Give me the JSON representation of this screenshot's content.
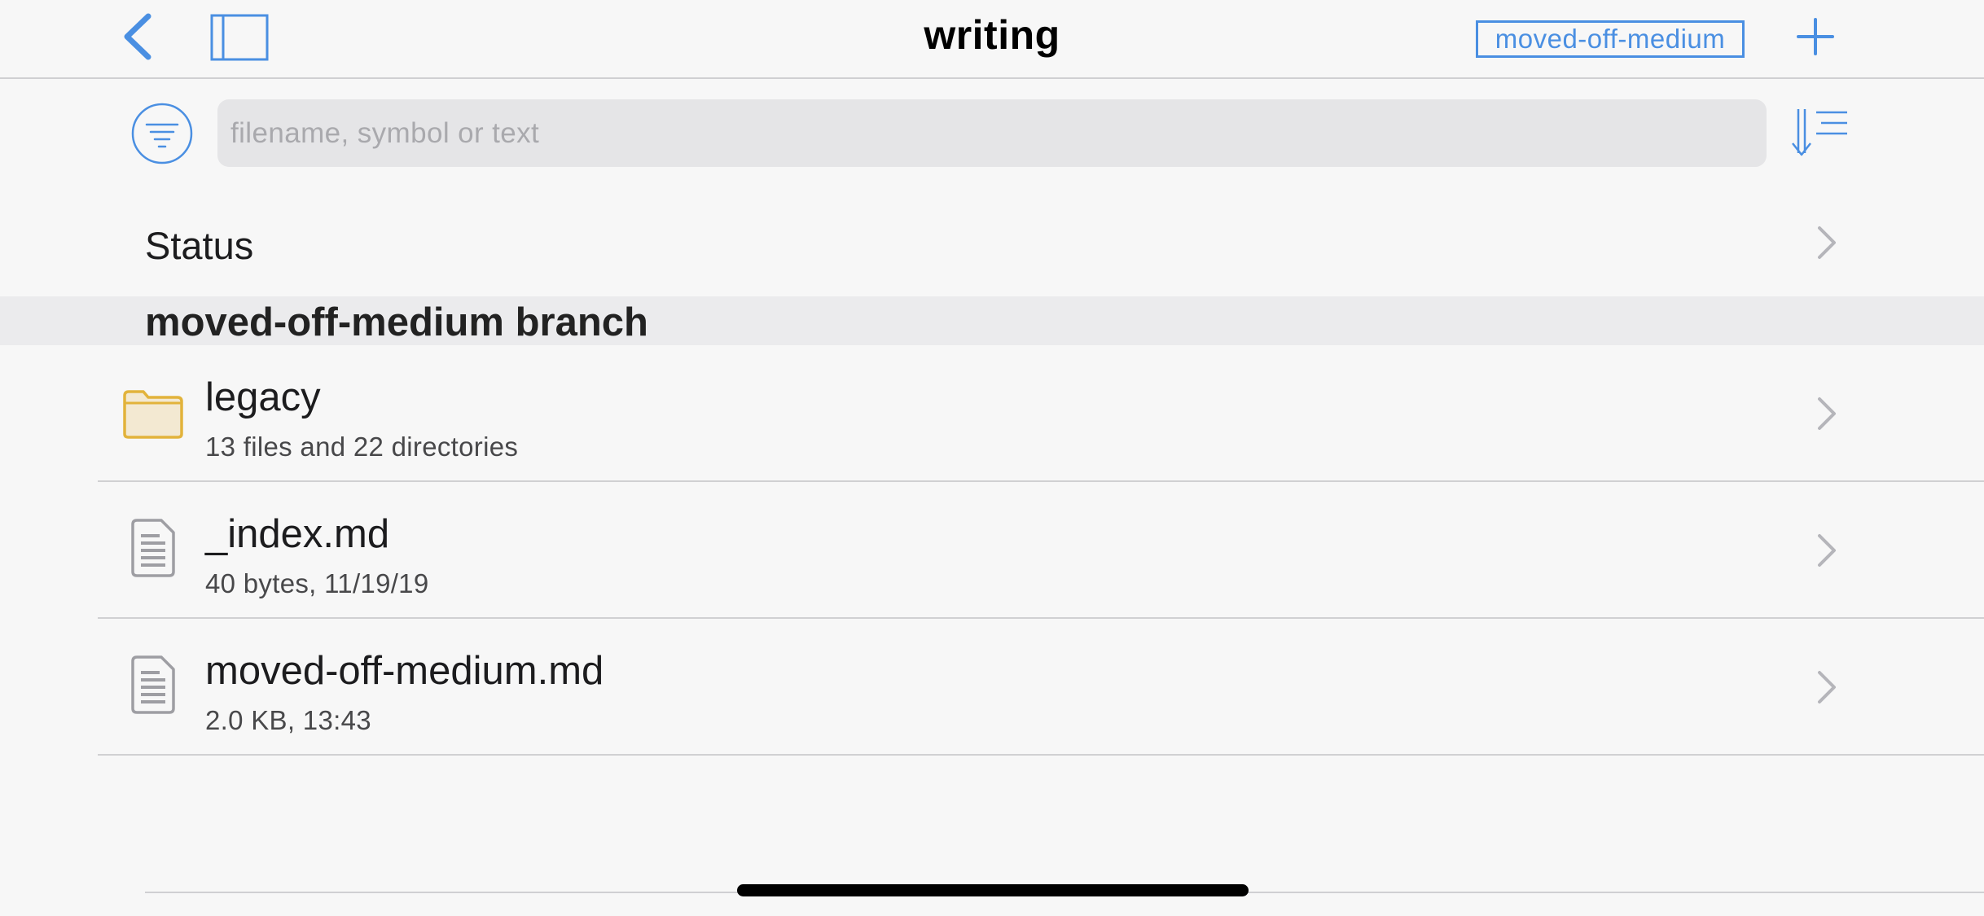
{
  "nav": {
    "title": "writing",
    "branch_badge": "moved-off-medium",
    "back_icon": "chevron-left-icon",
    "sidebar_icon": "sidebar-toggle-icon",
    "add_icon": "plus-icon"
  },
  "search": {
    "placeholder": "filename, symbol or text",
    "value": "",
    "filter_icon": "filter-icon",
    "sort_icon": "sort-icon"
  },
  "status": {
    "label": "Status"
  },
  "section": {
    "title": "moved-off-medium branch"
  },
  "files": [
    {
      "name": "legacy",
      "meta": "13 files and 22 directories",
      "icon": "folder-icon"
    },
    {
      "name": "_index.md",
      "meta": "40 bytes, 11/19/19",
      "icon": "document-icon"
    },
    {
      "name": "moved-off-medium.md",
      "meta": "2.0 KB, 13:43",
      "icon": "document-icon"
    }
  ],
  "colors": {
    "accent": "#4a8fe2",
    "folder_fill": "#f3e9d2",
    "folder_stroke": "#e2b33b",
    "doc_stroke": "#9e9ea3",
    "chevron": "#b5b5ba"
  }
}
